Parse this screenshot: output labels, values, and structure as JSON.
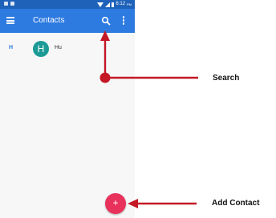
{
  "status_bar": {
    "time": "6:12",
    "ampm": "PM"
  },
  "app_bar": {
    "title": "Contacts",
    "icons": [
      "menu-icon",
      "search-icon",
      "more-vert-icon"
    ]
  },
  "contacts": [
    {
      "section": "H",
      "initial": "H",
      "name": "Hu"
    }
  ],
  "fab": {
    "symbol": "+"
  },
  "callouts": {
    "search": "Search",
    "add_contact": "Add Contact"
  },
  "colors": {
    "status_bar": "#1e62b9",
    "app_bar": "#2d7ae0",
    "avatar": "#1c9a95",
    "fab": "#e8315b",
    "annotation": "#c41826"
  }
}
